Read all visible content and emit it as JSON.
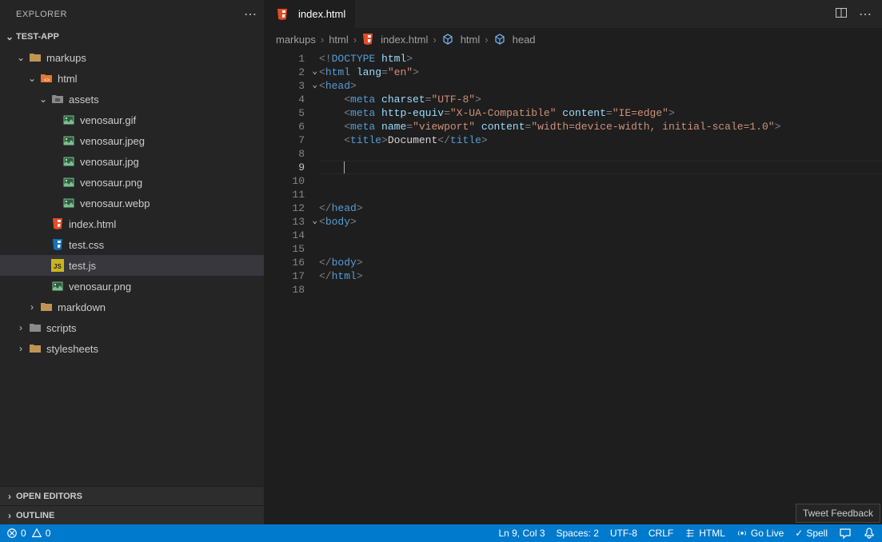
{
  "sidebar": {
    "title": "EXPLORER",
    "project": "TEST-APP",
    "panels": {
      "open_editors": "OPEN EDITORS",
      "outline": "OUTLINE"
    },
    "tree": [
      {
        "indent": 0,
        "chev": "down",
        "icon": "folder",
        "label": "markups",
        "sel": false
      },
      {
        "indent": 1,
        "chev": "down",
        "icon": "folder-html",
        "label": "html",
        "sel": false
      },
      {
        "indent": 2,
        "chev": "down",
        "icon": "folder-assets",
        "label": "assets",
        "sel": false
      },
      {
        "indent": 3,
        "chev": "",
        "icon": "image",
        "label": "venosaur.gif",
        "sel": false
      },
      {
        "indent": 3,
        "chev": "",
        "icon": "image",
        "label": "venosaur.jpeg",
        "sel": false
      },
      {
        "indent": 3,
        "chev": "",
        "icon": "image",
        "label": "venosaur.jpg",
        "sel": false
      },
      {
        "indent": 3,
        "chev": "",
        "icon": "image",
        "label": "venosaur.png",
        "sel": false
      },
      {
        "indent": 3,
        "chev": "",
        "icon": "image",
        "label": "venosaur.webp",
        "sel": false
      },
      {
        "indent": 2,
        "chev": "",
        "icon": "html5",
        "label": "index.html",
        "sel": false
      },
      {
        "indent": 2,
        "chev": "",
        "icon": "css3",
        "label": "test.css",
        "sel": false
      },
      {
        "indent": 2,
        "chev": "",
        "icon": "js",
        "label": "test.js",
        "sel": true
      },
      {
        "indent": 2,
        "chev": "",
        "icon": "image",
        "label": "venosaur.png",
        "sel": false
      },
      {
        "indent": 1,
        "chev": "right",
        "icon": "folder",
        "label": "markdown",
        "sel": false
      },
      {
        "indent": 0,
        "chev": "right",
        "icon": "folder-script",
        "label": "scripts",
        "sel": false
      },
      {
        "indent": 0,
        "chev": "right",
        "icon": "folder",
        "label": "stylesheets",
        "sel": false
      }
    ]
  },
  "tab": {
    "label": "index.html",
    "icon": "html5"
  },
  "breadcrumbs": [
    {
      "icon": "",
      "label": "markups"
    },
    {
      "icon": "",
      "label": "html"
    },
    {
      "icon": "html5",
      "label": "index.html"
    },
    {
      "icon": "cube",
      "label": "html"
    },
    {
      "icon": "cube",
      "label": "head"
    }
  ],
  "code": {
    "lines": [
      {
        "n": 1,
        "fold": "",
        "tokens": [
          [
            "punc",
            "<!"
          ],
          [
            "tag",
            "DOCTYPE "
          ],
          [
            "attr",
            "html"
          ],
          [
            "punc",
            ">"
          ]
        ],
        "ind": 0
      },
      {
        "n": 2,
        "fold": "down",
        "tokens": [
          [
            "punc",
            "<"
          ],
          [
            "tag",
            "html "
          ],
          [
            "attr",
            "lang"
          ],
          [
            "punc",
            "="
          ],
          [
            "str",
            "\"en\""
          ],
          [
            "punc",
            ">"
          ]
        ],
        "ind": 0
      },
      {
        "n": 3,
        "fold": "down",
        "tokens": [
          [
            "punc",
            "<"
          ],
          [
            "tag",
            "head"
          ],
          [
            "punc",
            ">"
          ]
        ],
        "ind": 0
      },
      {
        "n": 4,
        "fold": "",
        "tokens": [
          [
            "punc",
            "<"
          ],
          [
            "tag",
            "meta "
          ],
          [
            "attr",
            "charset"
          ],
          [
            "punc",
            "="
          ],
          [
            "str",
            "\"UTF-8\""
          ],
          [
            "punc",
            ">"
          ]
        ],
        "ind": 1
      },
      {
        "n": 5,
        "fold": "",
        "tokens": [
          [
            "punc",
            "<"
          ],
          [
            "tag",
            "meta "
          ],
          [
            "attr",
            "http-equiv"
          ],
          [
            "punc",
            "="
          ],
          [
            "str",
            "\"X-UA-Compatible\""
          ],
          [
            "attr",
            " content"
          ],
          [
            "punc",
            "="
          ],
          [
            "str",
            "\"IE=edge\""
          ],
          [
            "punc",
            ">"
          ]
        ],
        "ind": 1
      },
      {
        "n": 6,
        "fold": "",
        "tokens": [
          [
            "punc",
            "<"
          ],
          [
            "tag",
            "meta "
          ],
          [
            "attr",
            "name"
          ],
          [
            "punc",
            "="
          ],
          [
            "str",
            "\"viewport\""
          ],
          [
            "attr",
            " content"
          ],
          [
            "punc",
            "="
          ],
          [
            "str",
            "\"width=device-width, initial-scale=1.0\""
          ],
          [
            "punc",
            ">"
          ]
        ],
        "ind": 1
      },
      {
        "n": 7,
        "fold": "",
        "tokens": [
          [
            "punc",
            "<"
          ],
          [
            "tag",
            "title"
          ],
          [
            "punc",
            ">"
          ],
          [
            "text",
            "Document"
          ],
          [
            "punc",
            "</"
          ],
          [
            "tag",
            "title"
          ],
          [
            "punc",
            ">"
          ]
        ],
        "ind": 1
      },
      {
        "n": 8,
        "fold": "",
        "tokens": [],
        "ind": 0
      },
      {
        "n": 9,
        "fold": "",
        "tokens": [
          [
            "caret",
            ""
          ]
        ],
        "ind": 1,
        "current": true
      },
      {
        "n": 10,
        "fold": "",
        "tokens": [],
        "ind": 0
      },
      {
        "n": 11,
        "fold": "",
        "tokens": [],
        "ind": 0
      },
      {
        "n": 12,
        "fold": "",
        "tokens": [
          [
            "punc",
            "</"
          ],
          [
            "tag",
            "head"
          ],
          [
            "punc",
            ">"
          ]
        ],
        "ind": 0
      },
      {
        "n": 13,
        "fold": "down",
        "tokens": [
          [
            "punc",
            "<"
          ],
          [
            "tag",
            "body"
          ],
          [
            "punc",
            ">"
          ]
        ],
        "ind": 0
      },
      {
        "n": 14,
        "fold": "",
        "tokens": [],
        "ind": 0
      },
      {
        "n": 15,
        "fold": "",
        "tokens": [],
        "ind": 0
      },
      {
        "n": 16,
        "fold": "",
        "tokens": [
          [
            "punc",
            "</"
          ],
          [
            "tag",
            "body"
          ],
          [
            "punc",
            ">"
          ]
        ],
        "ind": 0
      },
      {
        "n": 17,
        "fold": "",
        "tokens": [
          [
            "punc",
            "</"
          ],
          [
            "tag",
            "html"
          ],
          [
            "punc",
            ">"
          ]
        ],
        "ind": 0
      },
      {
        "n": 18,
        "fold": "",
        "tokens": [],
        "ind": 0
      }
    ]
  },
  "statusbar": {
    "errors": "0",
    "warnings": "0",
    "cursor": "Ln 9, Col 3",
    "spaces": "Spaces: 2",
    "encoding": "UTF-8",
    "eol": "CRLF",
    "lang": "HTML",
    "golive": "Go Live",
    "spell": "Spell"
  },
  "tooltip": "Tweet Feedback"
}
